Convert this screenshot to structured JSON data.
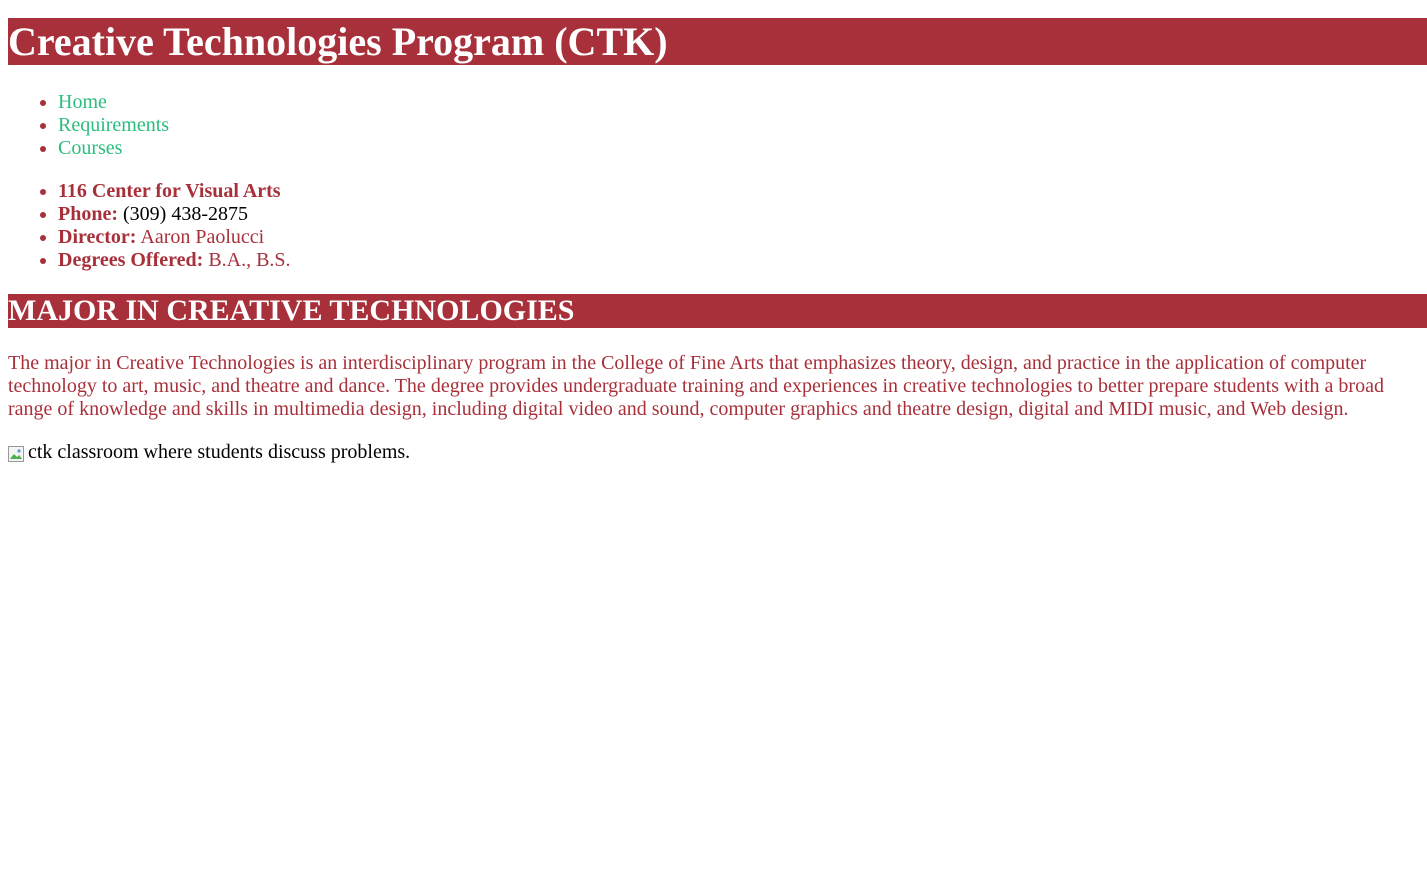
{
  "header": {
    "title": "Creative Technologies Program (CTK)"
  },
  "nav": {
    "items": [
      {
        "label": "Home"
      },
      {
        "label": "Requirements"
      },
      {
        "label": "Courses"
      }
    ]
  },
  "info": {
    "location": "116 Center for Visual Arts",
    "phone_label": "Phone:",
    "phone_value": "(309) 438-2875",
    "director_label": "Director:",
    "director_value": "Aaron Paolucci",
    "degrees_label": "Degrees Offered:",
    "degrees_value": "B.A., B.S."
  },
  "section": {
    "heading": "MAJOR IN CREATIVE TECHNOLOGIES",
    "paragraph": "The major in Creative Technologies is an interdisciplinary program in the College of Fine Arts that emphasizes theory, design, and practice in the application of computer technology to art, music, and theatre and dance. The degree provides undergraduate training and experiences in creative technologies to better prepare students with a broad range of knowledge and skills in multimedia design, including digital video and sound, computer graphics and theatre design, digital and MIDI music, and Web design.",
    "image_alt": "ctk classroom where students discuss problems."
  },
  "colors": {
    "brand_red": "#a8303a",
    "link_green": "#2bbd7e",
    "text_black": "#000000"
  },
  "icons": {
    "broken_image": "broken-image-icon"
  }
}
